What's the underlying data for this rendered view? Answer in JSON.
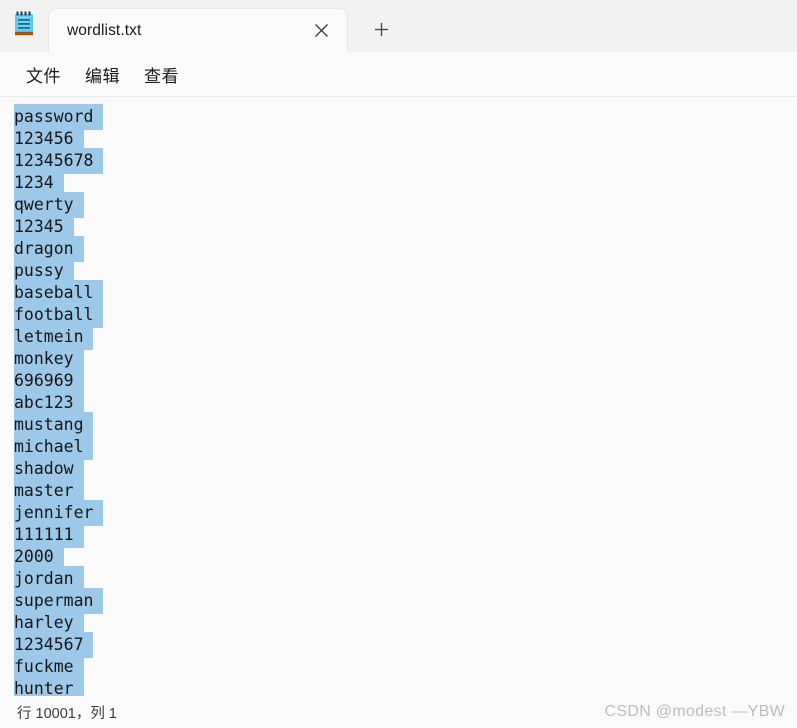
{
  "window": {
    "app_icon": "notepad-icon",
    "colors": {
      "titlebar_bg": "#f2f2f2",
      "tab_bg": "#fbfbfb",
      "menubar_bg": "#fafafa",
      "editor_bg": "#fafafa",
      "selection": "#9ec8e8",
      "text": "#161616",
      "watermark": "#bdbdbd"
    }
  },
  "tabs": [
    {
      "label": "wordlist.txt",
      "close_icon": "close-icon",
      "active": true
    }
  ],
  "new_tab": {
    "icon": "plus-icon",
    "label": "+"
  },
  "menu": {
    "items": [
      {
        "label": "文件"
      },
      {
        "label": "编辑"
      },
      {
        "label": "查看"
      }
    ]
  },
  "editor": {
    "selected_all": true,
    "lines": [
      "password",
      "123456",
      "12345678",
      "1234",
      "qwerty",
      "12345",
      "dragon",
      "pussy",
      "baseball",
      "football",
      "letmein",
      "monkey",
      "696969",
      "abc123",
      "mustang",
      "michael",
      "shadow",
      "master",
      "jennifer",
      "111111",
      "2000",
      "jordan",
      "superman",
      "harley",
      "1234567",
      "fuckme",
      "hunter"
    ]
  },
  "statusbar": {
    "position": "行 10001，列 1"
  },
  "watermark": {
    "text": "CSDN @modest —YBW"
  }
}
